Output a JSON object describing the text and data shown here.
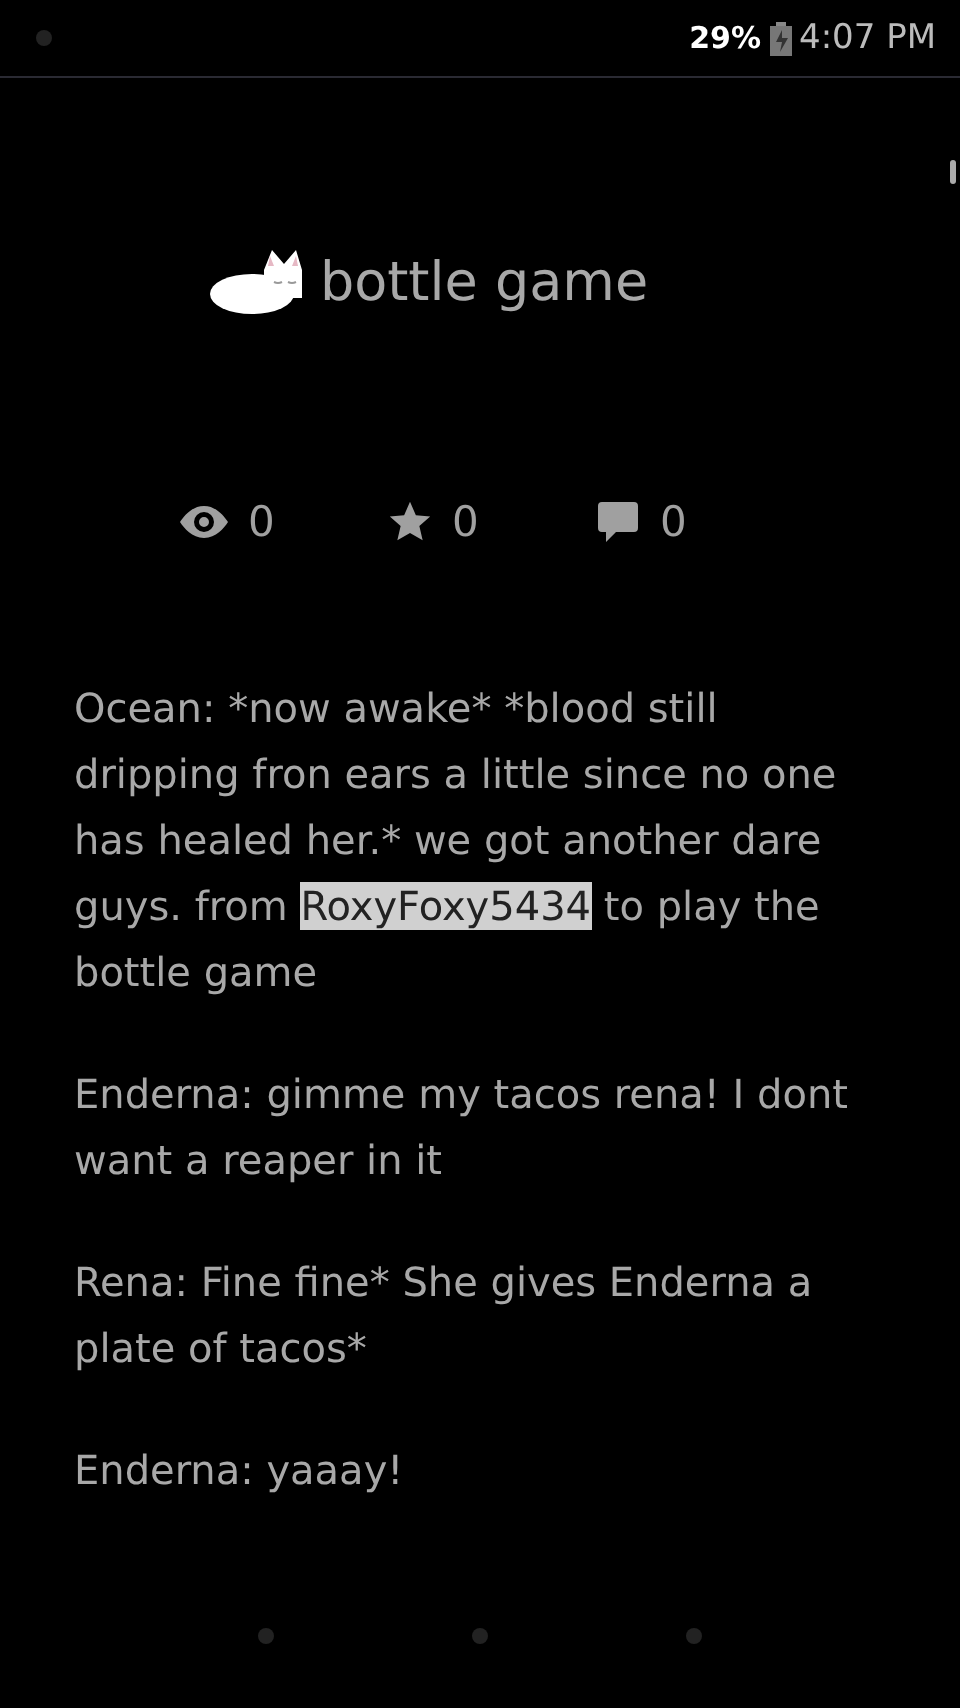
{
  "status_bar": {
    "battery_percent": "29%",
    "time": "4:07 PM"
  },
  "story": {
    "title": "bottle game"
  },
  "stats": [
    {
      "kind": "views",
      "count": "0"
    },
    {
      "kind": "stars",
      "count": "0"
    },
    {
      "kind": "comments",
      "count": "0"
    }
  ],
  "paragraphs": [
    {
      "segments": [
        {
          "text": "Ocean: *now awake* *blood still dripping fron ears a little since no one has healed her.* we got another dare guys. from ",
          "highlighted": false
        },
        {
          "text": "RoxyFoxy5434",
          "highlighted": true
        },
        {
          "text": " to play the bottle game",
          "highlighted": false
        }
      ]
    },
    {
      "segments": [
        {
          "text": "Enderna: gimme my tacos rena! I dont want a reaper in it",
          "highlighted": false
        }
      ]
    },
    {
      "segments": [
        {
          "text": "Rena: Fine fine* She gives Enderna a plate of tacos*",
          "highlighted": false
        }
      ]
    },
    {
      "segments": [
        {
          "text": "Enderna: yaaay!",
          "highlighted": false
        }
      ]
    }
  ]
}
